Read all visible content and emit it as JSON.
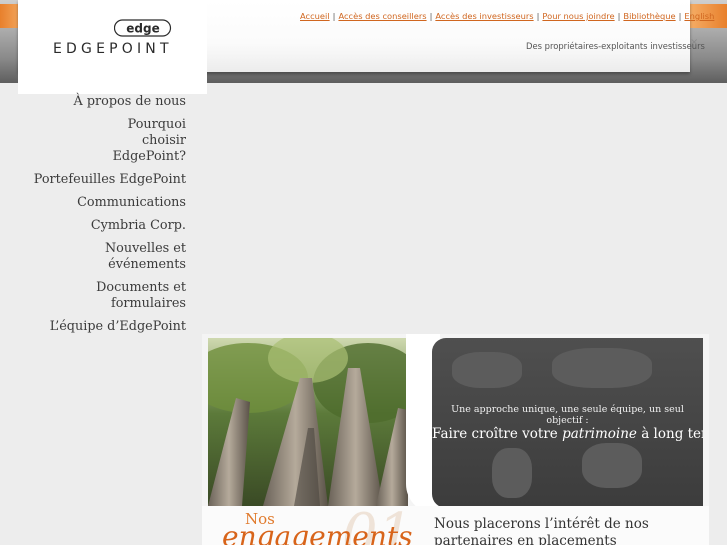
{
  "brand": {
    "name": "EDGEPOINT",
    "mark": "edge",
    "accent_color": "#d0661f",
    "orange_color": "#e8802c"
  },
  "top_nav": {
    "items": [
      {
        "label": "Accueil"
      },
      {
        "label": "Accès des conseillers"
      },
      {
        "label": "Accès des investisseurs"
      },
      {
        "label": "Pour nous joindre"
      },
      {
        "label": "Bibliothèque"
      },
      {
        "label": "English"
      }
    ],
    "separator": "|"
  },
  "tagline": "Des propriétaires-exploitants investisseurs",
  "close_symbol": "×",
  "sidebar": {
    "items": [
      {
        "label": "À propos de nous"
      },
      {
        "label": "Pourquoi choisir EdgePoint?"
      },
      {
        "label": "Portefeuilles EdgePoint"
      },
      {
        "label": "Communications"
      },
      {
        "label": "Cymbria Corp."
      },
      {
        "label": "Nouvelles et événements"
      },
      {
        "label": "Documents et formulaires"
      },
      {
        "label": "L’équipe d’EdgePoint"
      }
    ]
  },
  "banner": {
    "line1": "Une approche unique, une seule équipe, un seul objectif :",
    "line2_prefix": "Faire croître votre ",
    "line2_emphasis": "patrimoine",
    "line2_suffix": " à long terme"
  },
  "commitments": {
    "heading_small": "Nos",
    "heading_large": "engagements",
    "number": "01",
    "text": "Nous placerons l’intérêt de nos partenaires en placements (investisseurs et leurs"
  }
}
